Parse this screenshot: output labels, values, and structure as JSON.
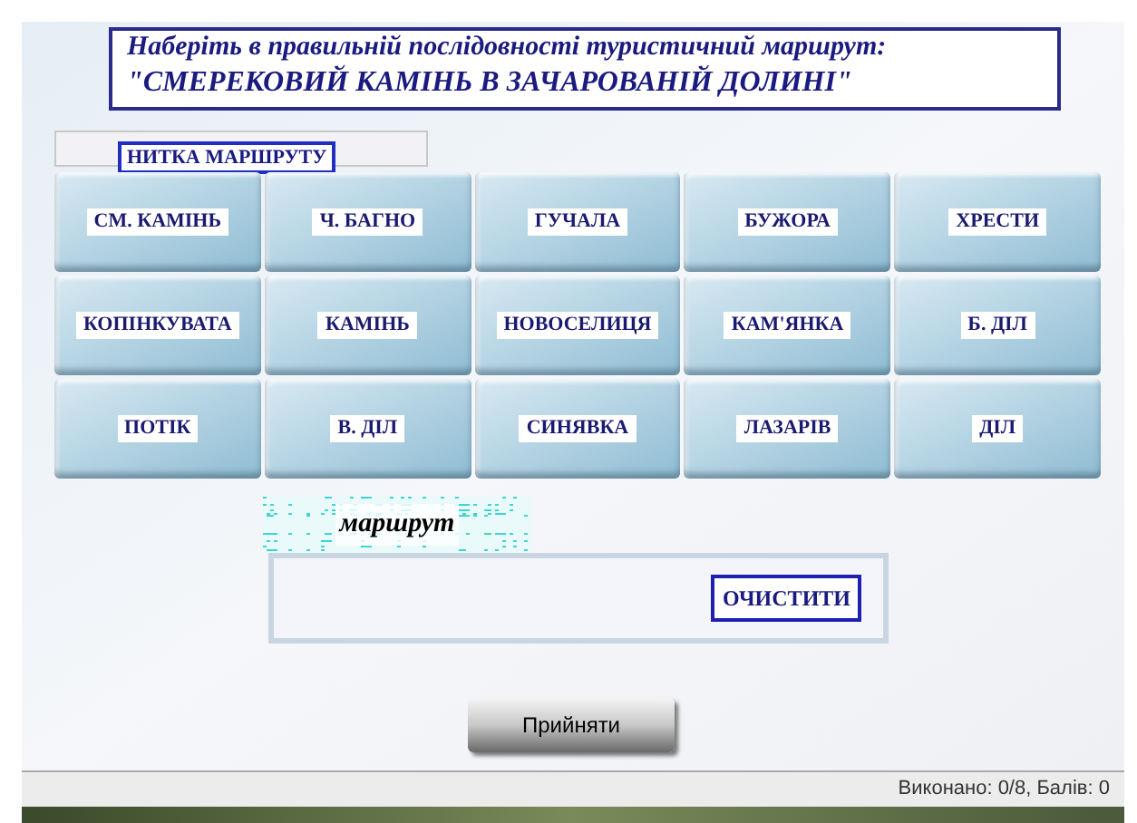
{
  "instruction": {
    "line_1": "Наберіть в правильній послідовності туристичний маршрут:",
    "line_2": "\"СМЕРЕКОВИЙ КАМІНЬ В ЗАЧАРОВАНІЙ ДОЛИНІ\""
  },
  "route_label": "НИТКА МАРШРУТУ",
  "places": [
    "СМ. КАМІНЬ",
    "Ч. БАГНО",
    "ГУЧАЛА",
    "БУЖОРА",
    "ХРЕСТИ",
    "КОПІНКУВАТА",
    "КАМІНЬ",
    "НОВОСЕЛИЦЯ",
    "КАМ'ЯНКА",
    "Б. ДІЛ",
    "ПОТІК",
    "В. ДІЛ",
    "СИНЯВКА",
    "ЛАЗАРІВ",
    "ДІЛ"
  ],
  "answer": {
    "label": "маршрут",
    "clear_button": "ОЧИСТИТИ"
  },
  "accept_button": "Прийняти",
  "status_bar": "Виконано: 0/8, Балів: 0"
}
